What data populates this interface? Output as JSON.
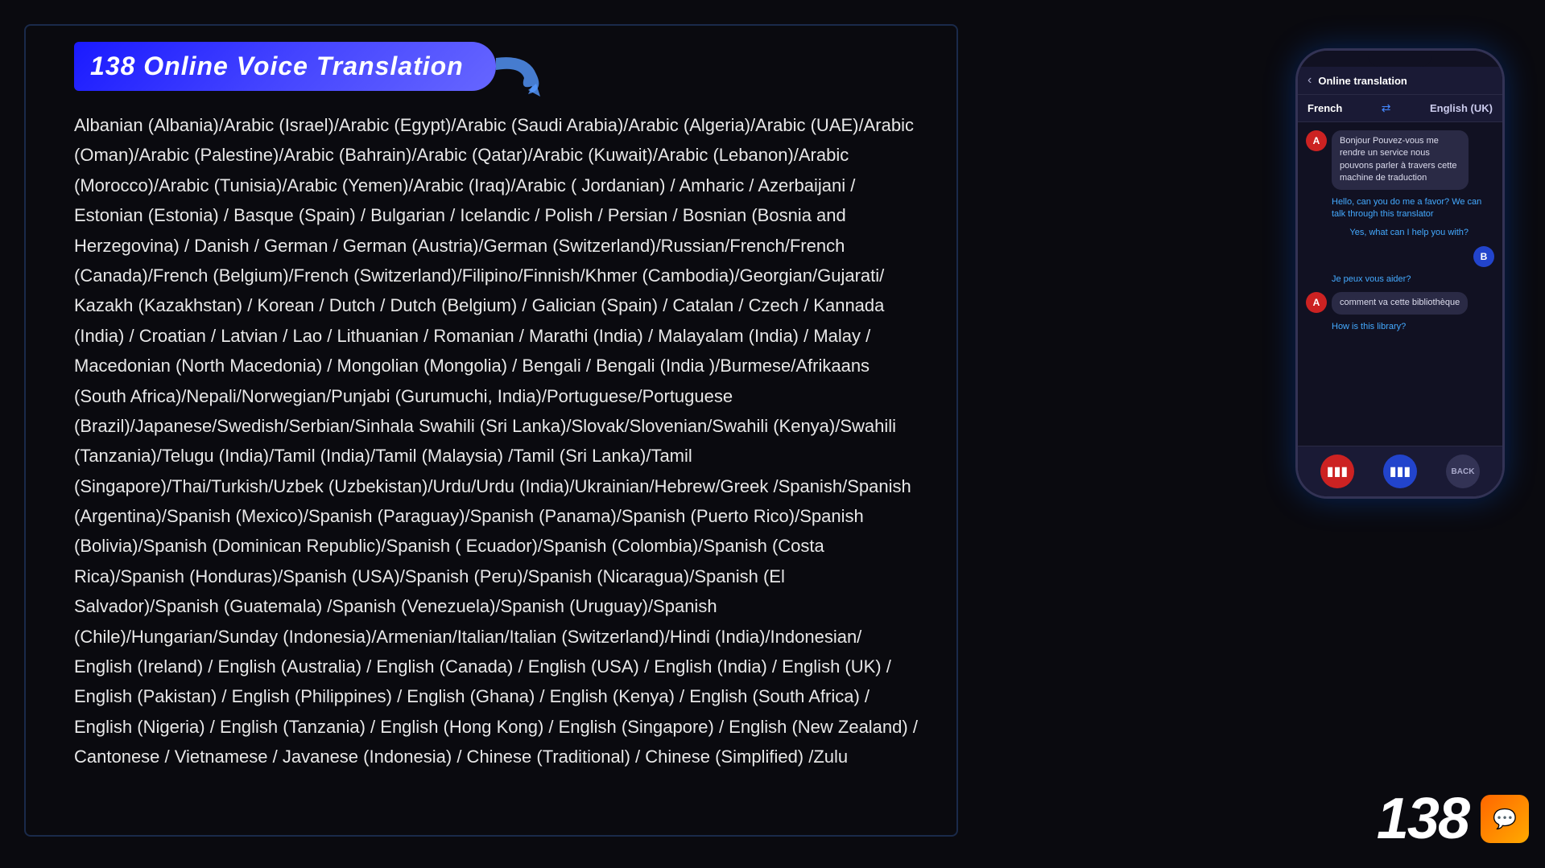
{
  "title": {
    "number": "138",
    "subtitle": "Online Voice Translation",
    "full": "138 Online Voice Translation"
  },
  "languages_text": "Albanian (Albania)/Arabic (Israel)/Arabic (Egypt)/Arabic (Saudi Arabia)/Arabic (Algeria)/Arabic (UAE)/Arabic (Oman)/Arabic (Palestine)/Arabic (Bahrain)/Arabic (Qatar)/Arabic (Kuwait)/Arabic (Lebanon)/Arabic (Morocco)/Arabic (Tunisia)/Arabic (Yemen)/Arabic (Iraq)/Arabic ( Jordanian) / Amharic / Azerbaijani / Estonian (Estonia) / Basque (Spain) / Bulgarian / Icelandic / Polish / Persian / Bosnian (Bosnia and Herzegovina) / Danish / German / German (Austria)/German (Switzerland)/Russian/French/French (Canada)/French (Belgium)/French (Switzerland)/Filipino/Finnish/Khmer (Cambodia)/Georgian/Gujarati/ Kazakh (Kazakhstan) / Korean / Dutch / Dutch (Belgium) / Galician (Spain) / Catalan / Czech / Kannada (India) / Croatian / Latvian / Lao / Lithuanian / Romanian / Marathi (India) / Malayalam (India) / Malay / Macedonian (North Macedonia) / Mongolian (Mongolia) / Bengali / Bengali (India )/Burmese/Afrikaans (South Africa)/Nepali/Norwegian/Punjabi (Gurumuchi, India)/Portuguese/Portuguese (Brazil)/Japanese/Swedish/Serbian/Sinhala Swahili (Sri Lanka)/Slovak/Slovenian/Swahili (Kenya)/Swahili (Tanzania)/Telugu (India)/Tamil (India)/Tamil (Malaysia) /Tamil (Sri Lanka)/Tamil (Singapore)/Thai/Turkish/Uzbek (Uzbekistan)/Urdu/Urdu (India)/Ukrainian/Hebrew/Greek /Spanish/Spanish (Argentina)/Spanish (Mexico)/Spanish (Paraguay)/Spanish (Panama)/Spanish (Puerto Rico)/Spanish (Bolivia)/Spanish (Dominican Republic)/Spanish ( Ecuador)/Spanish (Colombia)/Spanish (Costa Rica)/Spanish (Honduras)/Spanish (USA)/Spanish (Peru)/Spanish (Nicaragua)/Spanish (El Salvador)/Spanish (Guatemala) /Spanish (Venezuela)/Spanish (Uruguay)/Spanish (Chile)/Hungarian/Sunday (Indonesia)/Armenian/Italian/Italian (Switzerland)/Hindi (India)/Indonesian/ English (Ireland) / English (Australia) / English (Canada) / English (USA) / English (India) / English (UK) / English (Pakistan) / English (Philippines) / English (Ghana) / English (Kenya) / English (South Africa) / English (Nigeria) / English (Tanzania) / English (Hong Kong) / English (Singapore) / English (New Zealand) / Cantonese / Vietnamese / Javanese (Indonesia) / Chinese (Traditional) / Chinese (Simplified) /Zulu",
  "phone": {
    "header_title": "Online translation",
    "back_label": "‹",
    "lang_from": "French",
    "lang_to": "English (UK)",
    "swap_icon": "⇄",
    "messages": [
      {
        "side": "left",
        "avatar": "A",
        "text": "Bonjour Pouvez-vous me rendre un service nous pouvons parler à travers cette machine de traduction",
        "translation": "Hello, can you do me a favor? We can talk through this translator"
      },
      {
        "side": "right",
        "avatar": "B",
        "text": "",
        "translation": "Yes, what can I help you with?"
      },
      {
        "side": "left",
        "avatar": "A",
        "text": "",
        "translation": "Je peux vous aider?"
      },
      {
        "side": "left",
        "avatar": "A",
        "text": "comment va cette bibliothèque",
        "translation": "How is this library?"
      }
    ],
    "controls": {
      "mic1_label": "🎙",
      "mic2_label": "🎙",
      "back_label": "BACK"
    }
  },
  "bottom_right": {
    "number": "138",
    "logo_icon": "💬"
  }
}
